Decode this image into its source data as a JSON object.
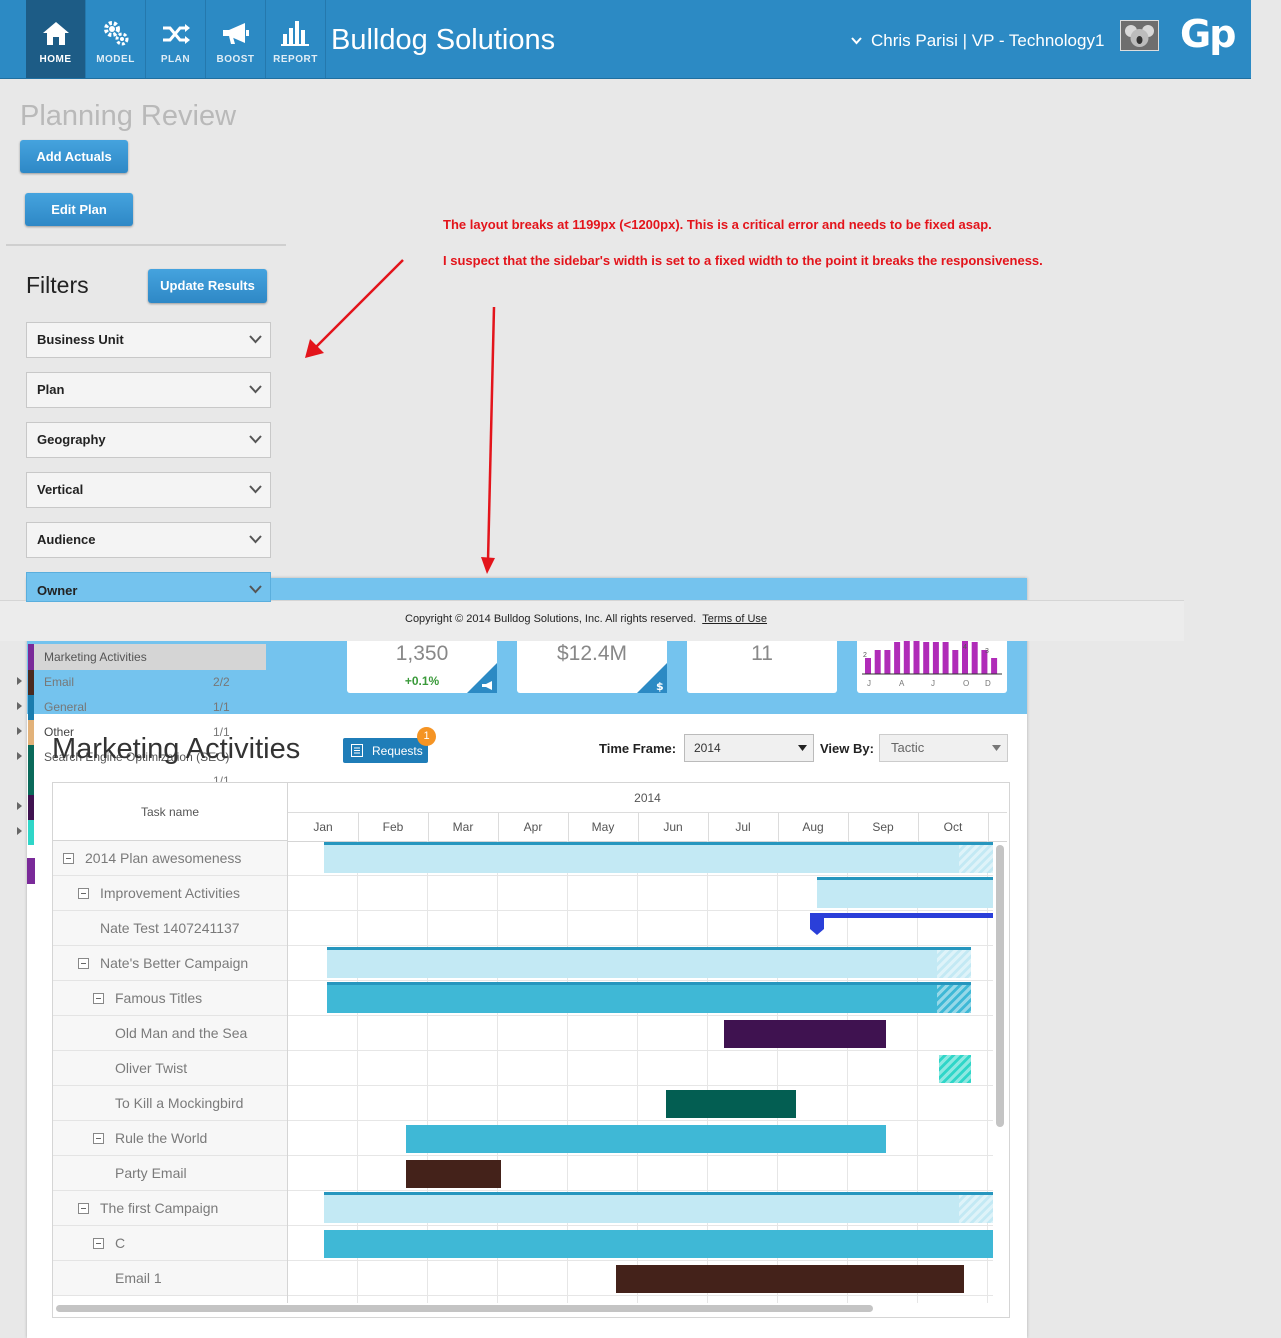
{
  "nav": {
    "items": [
      {
        "label": "HOME",
        "icon": "home-icon"
      },
      {
        "label": "MODEL",
        "icon": "gears-icon"
      },
      {
        "label": "PLAN",
        "icon": "shuffle-icon"
      },
      {
        "label": "BOOST",
        "icon": "megaphone-icon"
      },
      {
        "label": "REPORT",
        "icon": "bar-chart-icon"
      }
    ],
    "brand": "Bulldog Solutions",
    "user": "Chris Parisi  |  VP - Technology1",
    "logo": "Gp"
  },
  "page": {
    "title": "Planning Review",
    "add_actuals": "Add Actuals",
    "edit_plan": "Edit Plan"
  },
  "filters": {
    "heading": "Filters",
    "update": "Update Results",
    "items": [
      "Business Unit",
      "Plan",
      "Geography",
      "Vertical",
      "Audience",
      "Owner"
    ]
  },
  "notes": {
    "line1": "The layout breaks at 1199px (<1200px). This is a critical error and needs to be fixed asap.",
    "line2": "I suspect that the sidebar's width is set to a fixed width to the point it breaks the responsiveness."
  },
  "footer": {
    "copyright": "Copyright © 2014 Bulldog Solutions, Inc. All rights reserved.",
    "terms": "Terms of Use"
  },
  "cards": {
    "c1_value": "1,350",
    "c1_delta": "+0.1%",
    "c2_value": "$12.4M",
    "c3_value": "11",
    "mini_labels": [
      "J",
      "A",
      "J",
      "O",
      "D"
    ],
    "mini_values": [
      2,
      4,
      3
    ],
    "mini_bars": [
      2,
      3,
      3,
      4,
      5,
      5,
      4,
      4,
      4,
      3,
      5,
      4,
      3,
      2
    ]
  },
  "left_list": {
    "header": "Marketing Activities",
    "rows": [
      {
        "label": "Email",
        "count": "2/2",
        "color": "#4a2a20"
      },
      {
        "label": "General",
        "count": "1/1",
        "color": "#1a7cae"
      },
      {
        "label": "Other",
        "count": "1/1",
        "color": "#e2b27a"
      },
      {
        "label": "Search Engine Optimization (SEO)",
        "count": "1/1",
        "color": "#0a6a5a"
      }
    ]
  },
  "activities": {
    "title": "Marketing Activities",
    "requests": "Requests",
    "requests_badge": "1",
    "timeframe_label": "Time Frame:",
    "timeframe_value": "2014",
    "viewby_label": "View By:",
    "viewby_value": "Tactic"
  },
  "gantt": {
    "task_header": "Task name",
    "year": "2014",
    "months": [
      "Jan",
      "Feb",
      "Mar",
      "Apr",
      "May",
      "Jun",
      "Jul",
      "Aug",
      "Sep",
      "Oct"
    ],
    "rows": [
      {
        "name": "2014 Plan awesomeness",
        "level": 0,
        "toggle": true
      },
      {
        "name": "Improvement Activities",
        "level": 1,
        "toggle": true
      },
      {
        "name": "Nate Test 1407241137",
        "level": 2,
        "toggle": false
      },
      {
        "name": "Nate's Better Campaign",
        "level": 1,
        "toggle": true
      },
      {
        "name": "Famous Titles",
        "level": 2,
        "toggle": true
      },
      {
        "name": "Old Man and the Sea",
        "level": 3,
        "toggle": false
      },
      {
        "name": "Oliver Twist",
        "level": 3,
        "toggle": false
      },
      {
        "name": "To Kill a Mockingbird",
        "level": 3,
        "toggle": false
      },
      {
        "name": "Rule the World",
        "level": 2,
        "toggle": true
      },
      {
        "name": "Party Email",
        "level": 3,
        "toggle": false
      },
      {
        "name": "The first Campaign",
        "level": 1,
        "toggle": true
      },
      {
        "name": "C",
        "level": 2,
        "toggle": true
      },
      {
        "name": "Email 1",
        "level": 3,
        "toggle": false
      }
    ],
    "colors": {
      "light": "#c3e9f4",
      "mid": "#3fb8d6",
      "purple": "#3f1250",
      "cyan": "#2fd6c8",
      "teal": "#035e52",
      "brown": "#44221a",
      "blue": "#2a3fd9",
      "topline": "#2696be"
    }
  }
}
